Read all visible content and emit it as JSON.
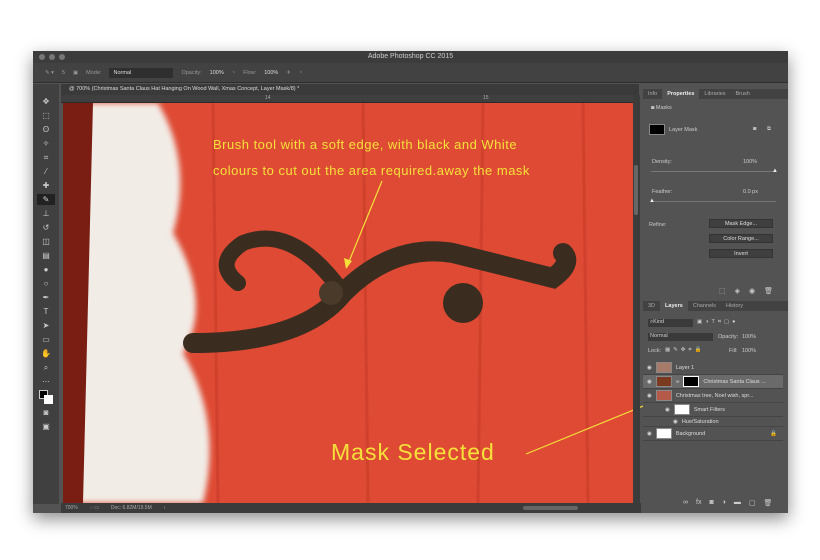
{
  "app": {
    "title": "Adobe Photoshop CC 2015"
  },
  "options": {
    "mode_label": "Mode:",
    "mode": "Normal",
    "opacity_label": "Opacity:",
    "opacity": "100%",
    "flow_label": "Flow:",
    "flow": "100%",
    "brush_size": "5"
  },
  "document": {
    "tab": "@ 700% (Christmas Santa Claus Hat Hanging On Wood Wall, Xmas Concept, Layer Mask/8) *",
    "ruler": [
      "14",
      "15"
    ],
    "zoom": "700%",
    "doc_size": "Doc: 6.82M/19.5M"
  },
  "annotations": {
    "line1": "Brush tool with a soft edge, with black and White",
    "line2": "colours to cut  out the area required.away the mask",
    "mask_selected": "Mask Selected"
  },
  "properties": {
    "tabs": [
      "Info",
      "Properties",
      "Libraries",
      "Brush"
    ],
    "section": "Masks",
    "mask_label": "Layer Mask",
    "density_label": "Density:",
    "density": "100%",
    "density_value": 100,
    "feather_label": "Feather:",
    "feather": "0.0 px",
    "feather_value": 0,
    "refine_label": "Refine:",
    "buttons": [
      "Mask Edge...",
      "Color Range...",
      "Invert"
    ]
  },
  "layers": {
    "tabs": [
      "3D",
      "Layers",
      "Channels",
      "History"
    ],
    "filter": "Kind",
    "blend": "Normal",
    "opacity_label": "Opacity:",
    "opacity": "100%",
    "lock_label": "Lock:",
    "fill_label": "Fill:",
    "fill": "100%",
    "items": [
      {
        "name": "Layer 1"
      },
      {
        "name": "Christmas Santa Claus ..."
      },
      {
        "name": "Christmas tree, Noel wish, spr..."
      },
      {
        "name": "Smart Filters"
      },
      {
        "name": "Hue/Saturation"
      },
      {
        "name": "Background"
      }
    ]
  }
}
